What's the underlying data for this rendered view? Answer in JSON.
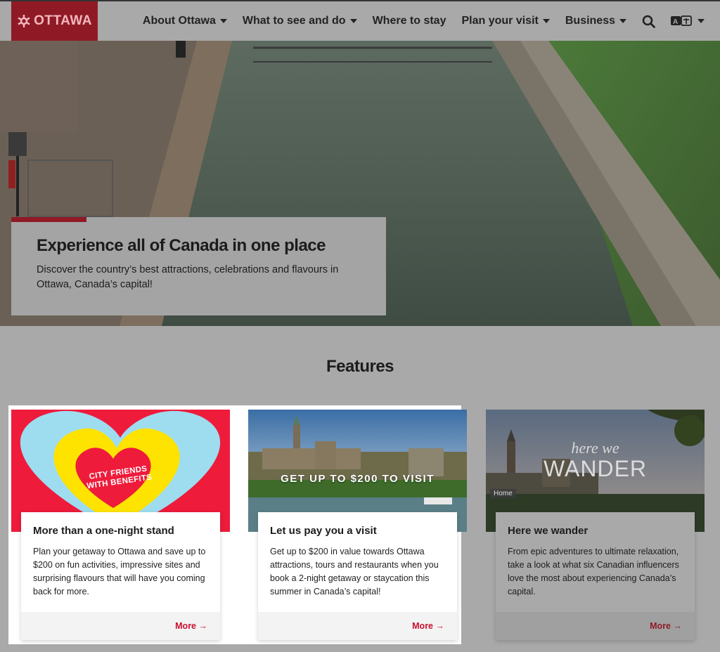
{
  "header": {
    "logo_text": "OTTAWA",
    "nav": [
      {
        "label": "About Ottawa",
        "dropdown": true
      },
      {
        "label": "What to see and do",
        "dropdown": true
      },
      {
        "label": "Where to stay",
        "dropdown": false
      },
      {
        "label": "Plan your visit",
        "dropdown": true
      },
      {
        "label": "Business",
        "dropdown": true
      }
    ],
    "search_icon": "search-icon",
    "language_icon": "translate-icon"
  },
  "hero": {
    "title": "Experience all of Canada in one place",
    "text": "Discover the country’s best attractions, celebrations and flavours in Ottawa, Canada’s capital!"
  },
  "features": {
    "title": "Features",
    "items": [
      {
        "image_text": "CITY FRIENDS WITH BENEFITS",
        "title": "More than a one-night stand",
        "text": "Plan your getaway to Ottawa and save up to $200 on fun activities, impressive sites and surprising flavours that will have you coming back for more.",
        "link": "More"
      },
      {
        "image_text": "GET UP TO $200 TO VISIT",
        "title": "Let us pay you a visit",
        "text": "Get up to $200 in value towards Ottawa attractions, tours and restaurants when you book a 2-night getaway or staycation this summer in Canada’s capital!",
        "link": "More"
      },
      {
        "image_text_line1": "here we",
        "image_text_line2": "WANDER",
        "image_badge": "Home",
        "title": "Here we wander",
        "text": "From epic adventures to ultimate relaxation, take a look at what six Canadian influencers love the most about experiencing Canada’s capital.",
        "link": "More"
      }
    ]
  },
  "colors": {
    "brand_red": "#c8102e",
    "overlay_gray": "#a9a9a9"
  }
}
